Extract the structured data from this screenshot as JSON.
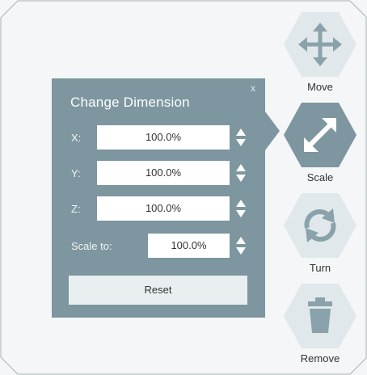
{
  "dialog": {
    "title": "Change Dimension",
    "close": "x",
    "rows": [
      {
        "label": "X:",
        "value": "100.0%"
      },
      {
        "label": "Y:",
        "value": "100.0%"
      },
      {
        "label": "Z:",
        "value": "100.0%"
      }
    ],
    "scale_to": {
      "label": "Scale to:",
      "value": "100.0%"
    },
    "reset_label": "Reset"
  },
  "tools": [
    {
      "label": "Move",
      "icon": "move-arrows-icon",
      "active": false
    },
    {
      "label": "Scale",
      "icon": "scale-arrows-icon",
      "active": true
    },
    {
      "label": "Turn",
      "icon": "rotate-icon",
      "active": false
    },
    {
      "label": "Remove",
      "icon": "trash-icon",
      "active": false
    }
  ],
  "colors": {
    "dialog_bg": "#7d969f",
    "active_hex": "#7d969f",
    "inactive_hex": "#e1e8eb",
    "icon_inactive": "#89a2ab",
    "icon_active": "#ffffff"
  }
}
